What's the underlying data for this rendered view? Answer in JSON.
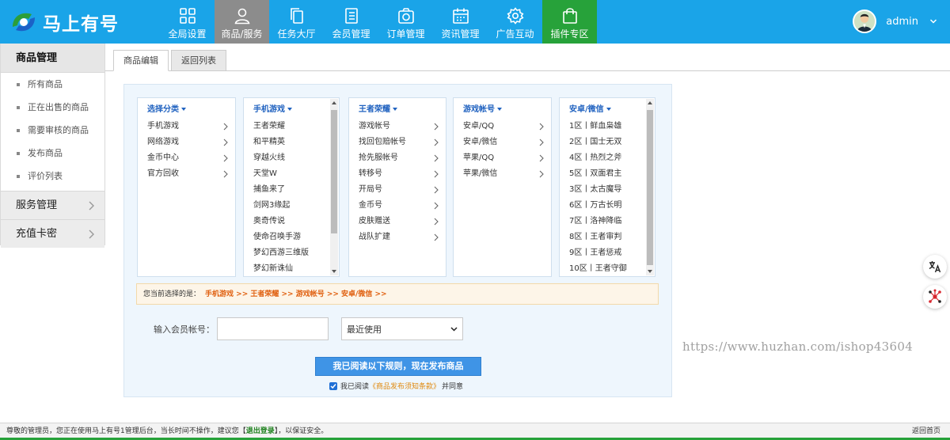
{
  "app": {
    "logo_text": "马上有号",
    "user_name": "admin"
  },
  "nav": [
    {
      "label": "全局设置",
      "icon": "grid-icon",
      "state": "normal"
    },
    {
      "label": "商品/服务",
      "icon": "user-icon",
      "state": "active"
    },
    {
      "label": "任务大厅",
      "icon": "copy-icon",
      "state": "normal"
    },
    {
      "label": "会员管理",
      "icon": "list-icon",
      "state": "normal"
    },
    {
      "label": "订单管理",
      "icon": "camera-icon",
      "state": "normal"
    },
    {
      "label": "资讯管理",
      "icon": "calendar-icon",
      "state": "normal"
    },
    {
      "label": "广告互动",
      "icon": "gear-icon",
      "state": "normal"
    },
    {
      "label": "插件专区",
      "icon": "bag-icon",
      "state": "plugin"
    }
  ],
  "sidebar": {
    "head": "商品管理",
    "items": [
      "所有商品",
      "正在出售的商品",
      "需要审核的商品",
      "发布商品",
      "评价列表"
    ],
    "groups": [
      "服务管理",
      "充值卡密"
    ]
  },
  "tabs": [
    "商品编辑",
    "返回列表"
  ],
  "columns": [
    {
      "head": "选择分类",
      "items": [
        "手机游戏",
        "网络游戏",
        "金币中心",
        "官方回收"
      ],
      "arrows": [
        true,
        true,
        true,
        true
      ],
      "scroll": false
    },
    {
      "head": "手机游戏",
      "items": [
        "王者荣耀",
        "和平精英",
        "穿越火线",
        "天堂W",
        "捕鱼来了",
        "剑网3缘起",
        "奥奇传说",
        "使命召唤手游",
        "梦幻西游三维版",
        "梦幻新诛仙"
      ],
      "arrows": [],
      "scroll": true
    },
    {
      "head": "王者荣耀",
      "items": [
        "游戏帐号",
        "找回包赔帐号",
        "抢先服帐号",
        "转移号",
        "开局号",
        "金币号",
        "皮肤赠送",
        "战队扩建"
      ],
      "arrows": [
        true,
        true,
        true,
        true,
        true,
        true,
        true,
        true
      ],
      "scroll": false
    },
    {
      "head": "游戏帐号",
      "items": [
        "安卓/QQ",
        "安卓/微信",
        "苹果/QQ",
        "苹果/微信"
      ],
      "arrows": [
        true,
        true,
        true,
        true
      ],
      "scroll": false
    },
    {
      "head": "安卓/微信",
      "items": [
        "1区丨鲜血枭雄",
        "2区丨国士无双",
        "4区丨热烈之斧",
        "5区丨双面君主",
        "3区丨太古魔导",
        "6区丨万古长明",
        "7区丨洛神降临",
        "8区丨王者审判",
        "9区丨王者惩戒",
        "10区丨王者守御"
      ],
      "arrows": [],
      "scroll": true
    }
  ],
  "selection": {
    "label": "您当前选择的是：",
    "path": "手机游戏 >> 王者荣耀 >> 游戏帐号 >> 安卓/微信 >>"
  },
  "member": {
    "label": "输入会员帐号：",
    "value": "",
    "select_value": "最近使用"
  },
  "publish_button": "我已阅读以下规则，现在发布商品",
  "agree": {
    "prefix": "我已阅读",
    "link": "《商品发布须知条款》",
    "suffix": "并同意",
    "checked": true
  },
  "watermark": "https://www.huzhan.com/ishop43604",
  "footer": {
    "text_before": "尊敬的管理员，您正在使用马上有号1管理后台，当长时间不操作，建议您【",
    "logout": "退出登录",
    "text_after": "】，以保证安全。",
    "home": "返回首页"
  },
  "colors": {
    "topbar": "#1aa4e8",
    "active_nav": "#8c8c8c",
    "plugin_nav": "#27a23a",
    "button": "#3f94e6",
    "path": "#e06010"
  }
}
